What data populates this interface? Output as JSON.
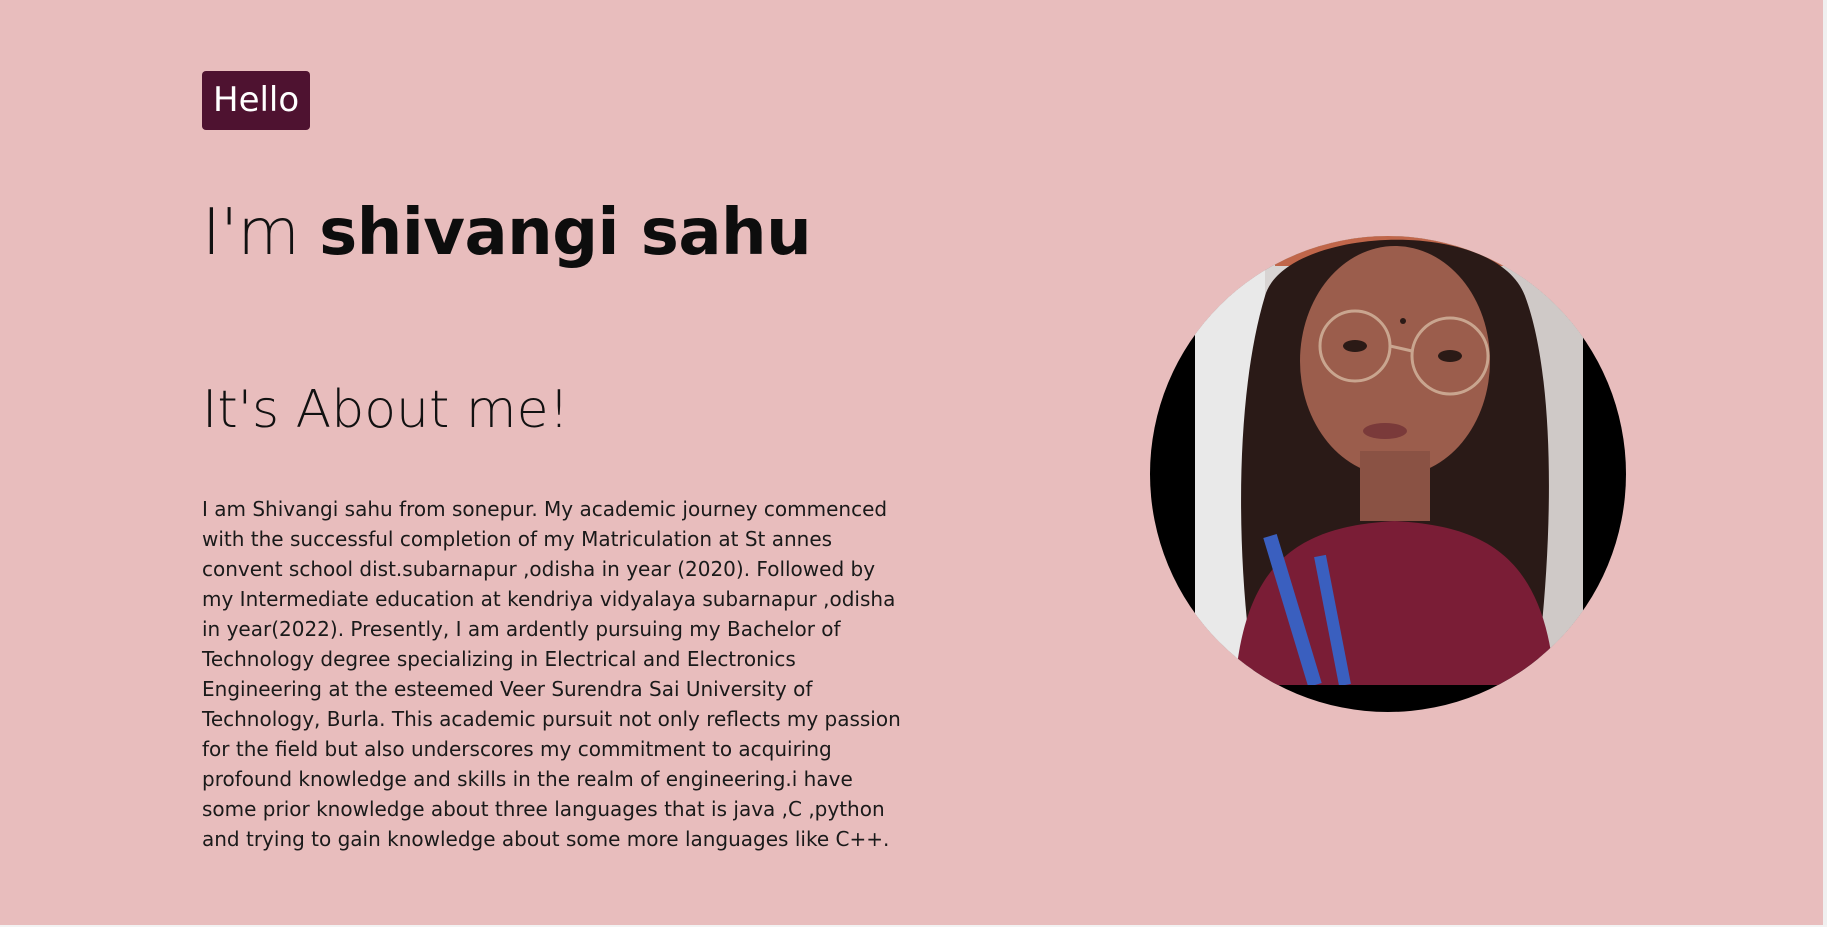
{
  "hero": {
    "greeting": "Hello",
    "intro_prefix": "I'm",
    "name": "shivangi sahu"
  },
  "about": {
    "heading": "It's About me!",
    "text": "I am Shivangi sahu from sonepur. My academic journey commenced with the successful completion of my Matriculation at St annes convent school dist.subarnapur ,odisha in year (2020). Followed by my Intermediate education at kendriya vidyalaya subarnapur ,odisha in year(2022). Presently, I am ardently pursuing my Bachelor of Technology degree specializing in Electrical and Electronics Engineering at the esteemed Veer Surendra Sai University of Technology, Burla. This academic pursuit not only reflects my passion for the field but also underscores my commitment to acquiring profound knowledge and skills in the realm of engineering.i have some prior knowledge about three languages that is java ,C ,python and trying to gain knowledge about some more languages like C++."
  },
  "colors": {
    "background": "#e8bdbd",
    "badge": "#4e1230",
    "text": "#111111"
  }
}
